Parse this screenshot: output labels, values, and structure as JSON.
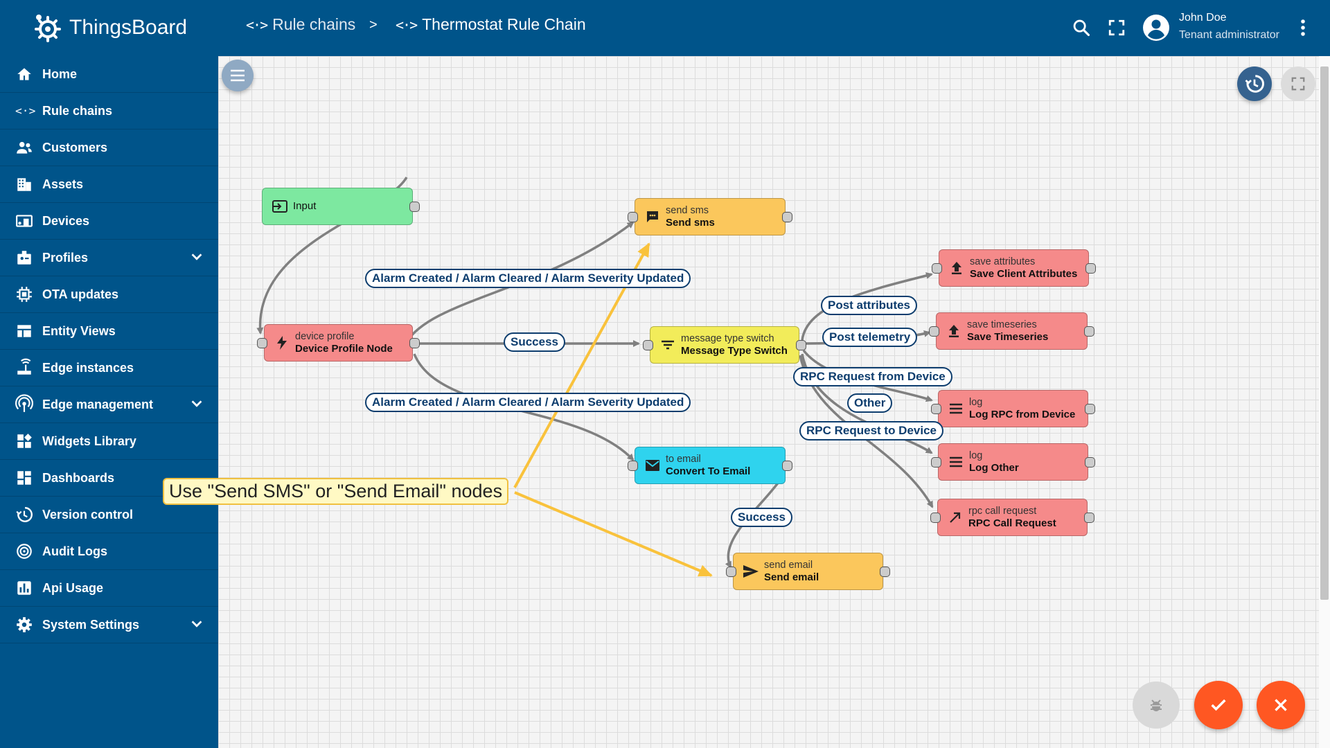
{
  "app": {
    "name": "ThingsBoard"
  },
  "sidebar": {
    "items": [
      {
        "label": "Home",
        "icon": "home-icon"
      },
      {
        "label": "Rule chains",
        "icon": "rule-chain-icon"
      },
      {
        "label": "Customers",
        "icon": "customers-icon"
      },
      {
        "label": "Assets",
        "icon": "assets-icon"
      },
      {
        "label": "Devices",
        "icon": "devices-icon"
      },
      {
        "label": "Profiles",
        "icon": "profiles-icon",
        "expandable": true
      },
      {
        "label": "OTA updates",
        "icon": "ota-icon"
      },
      {
        "label": "Entity Views",
        "icon": "entity-views-icon"
      },
      {
        "label": "Edge instances",
        "icon": "edge-icon"
      },
      {
        "label": "Edge management",
        "icon": "edge-management-icon",
        "expandable": true
      },
      {
        "label": "Widgets Library",
        "icon": "widgets-icon"
      },
      {
        "label": "Dashboards",
        "icon": "dashboards-icon"
      },
      {
        "label": "Version control",
        "icon": "history-icon"
      },
      {
        "label": "Audit Logs",
        "icon": "audit-icon"
      },
      {
        "label": "Api Usage",
        "icon": "api-usage-icon"
      },
      {
        "label": "System Settings",
        "icon": "settings-icon",
        "expandable": true
      }
    ]
  },
  "header": {
    "breadcrumb": [
      "Rule chains",
      ">",
      "Thermostat Rule Chain"
    ],
    "user_name": "John Doe",
    "user_role": "Tenant administrator"
  },
  "nodes": [
    {
      "id": "input",
      "type": "",
      "name": "Input",
      "color": "#7de8a0"
    },
    {
      "id": "device_profile",
      "type": "device profile",
      "name": "Device Profile Node",
      "color": "#f58a8a"
    },
    {
      "id": "send_sms",
      "type": "send sms",
      "name": "Send sms",
      "color": "#fbc75c"
    },
    {
      "id": "msg_switch",
      "type": "message type switch",
      "name": "Message Type Switch",
      "color": "#f2ec5a"
    },
    {
      "id": "to_email",
      "type": "to email",
      "name": "Convert To Email",
      "color": "#2fd3ee"
    },
    {
      "id": "send_email",
      "type": "send email",
      "name": "Send email",
      "color": "#fbc75c"
    },
    {
      "id": "save_attr",
      "type": "save attributes",
      "name": "Save Client Attributes",
      "color": "#f58a8a"
    },
    {
      "id": "save_ts",
      "type": "save timeseries",
      "name": "Save Timeseries",
      "color": "#f58a8a"
    },
    {
      "id": "log_rpc",
      "type": "log",
      "name": "Log RPC from Device",
      "color": "#f58a8a"
    },
    {
      "id": "log_other",
      "type": "log",
      "name": "Log Other",
      "color": "#f58a8a"
    },
    {
      "id": "rpc_call",
      "type": "rpc call request",
      "name": "RPC Call Request",
      "color": "#f58a8a"
    }
  ],
  "edge_labels": [
    "Alarm Created / Alarm Cleared / Alarm Severity Updated",
    "Success",
    "Alarm Created / Alarm Cleared / Alarm Severity Updated",
    "Post attributes",
    "Post telemetry",
    "RPC Request from Device",
    "Other",
    "RPC Request to Device",
    "Success"
  ],
  "callout": "Use \"Send SMS\" or \"Send Email\" nodes",
  "colors": {
    "primary": "#00548a",
    "accent": "#ff5722",
    "callout_arrow": "#f9c23c",
    "edge": "#808080"
  }
}
